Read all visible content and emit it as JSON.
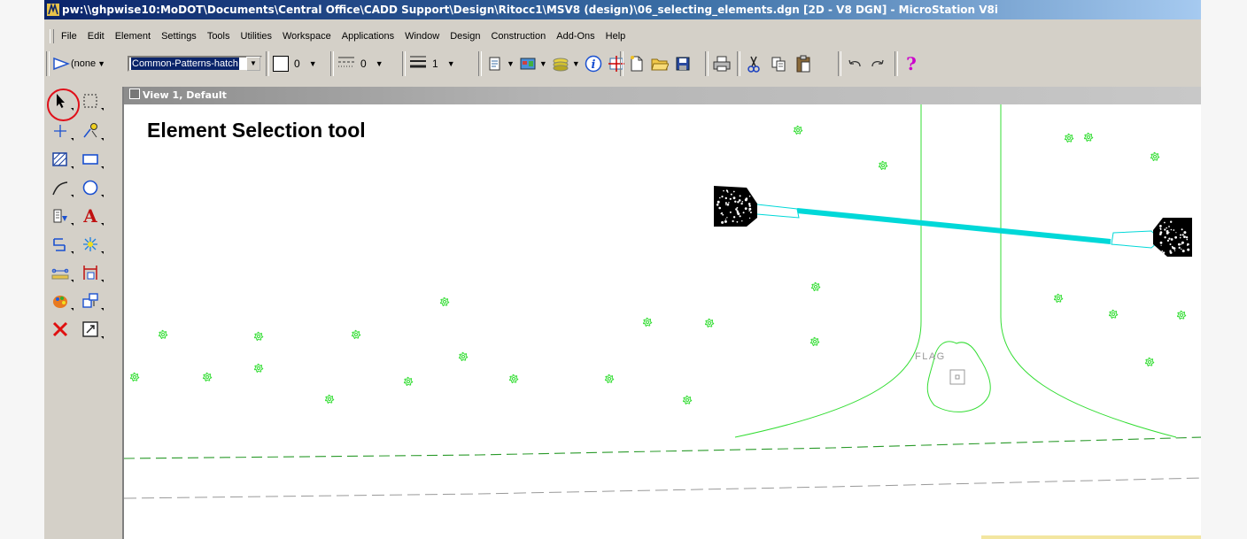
{
  "window": {
    "title": "pw:\\\\ghpwise10:MoDOT\\Documents\\Central Office\\CADD Support\\Design\\Ritocc1\\MSV8 (design)\\06_selecting_elements.dgn [2D - V8 DGN] - MicroStation V8i"
  },
  "menu": [
    "File",
    "Edit",
    "Element",
    "Settings",
    "Tools",
    "Utilities",
    "Workspace",
    "Applications",
    "Window",
    "Design",
    "Construction",
    "Add-Ons",
    "Help"
  ],
  "toolbar": {
    "level": "(none",
    "pattern": "Common-Patterns-hatch",
    "color_value": "0",
    "style_value": "0",
    "weight_value": "1"
  },
  "view": {
    "title": "View 1, Default",
    "label": "Element Selection tool",
    "cell_text": "FLAG"
  },
  "colors": {
    "linework": "#33dd33",
    "cyan_line": "#00d8d8",
    "highlight": "#e0101a"
  },
  "icons": [
    "element-selection-icon",
    "fence-icon",
    "place-line-icon",
    "measure-icon",
    "hatch-icon",
    "rectangle-icon",
    "arc-icon",
    "circle-icon",
    "cell-icon",
    "text-icon",
    "modify-icon",
    "detail-icon",
    "dimension-icon",
    "align-icon",
    "symbology-icon",
    "group-icon",
    "delete-icon",
    "view-icon"
  ]
}
